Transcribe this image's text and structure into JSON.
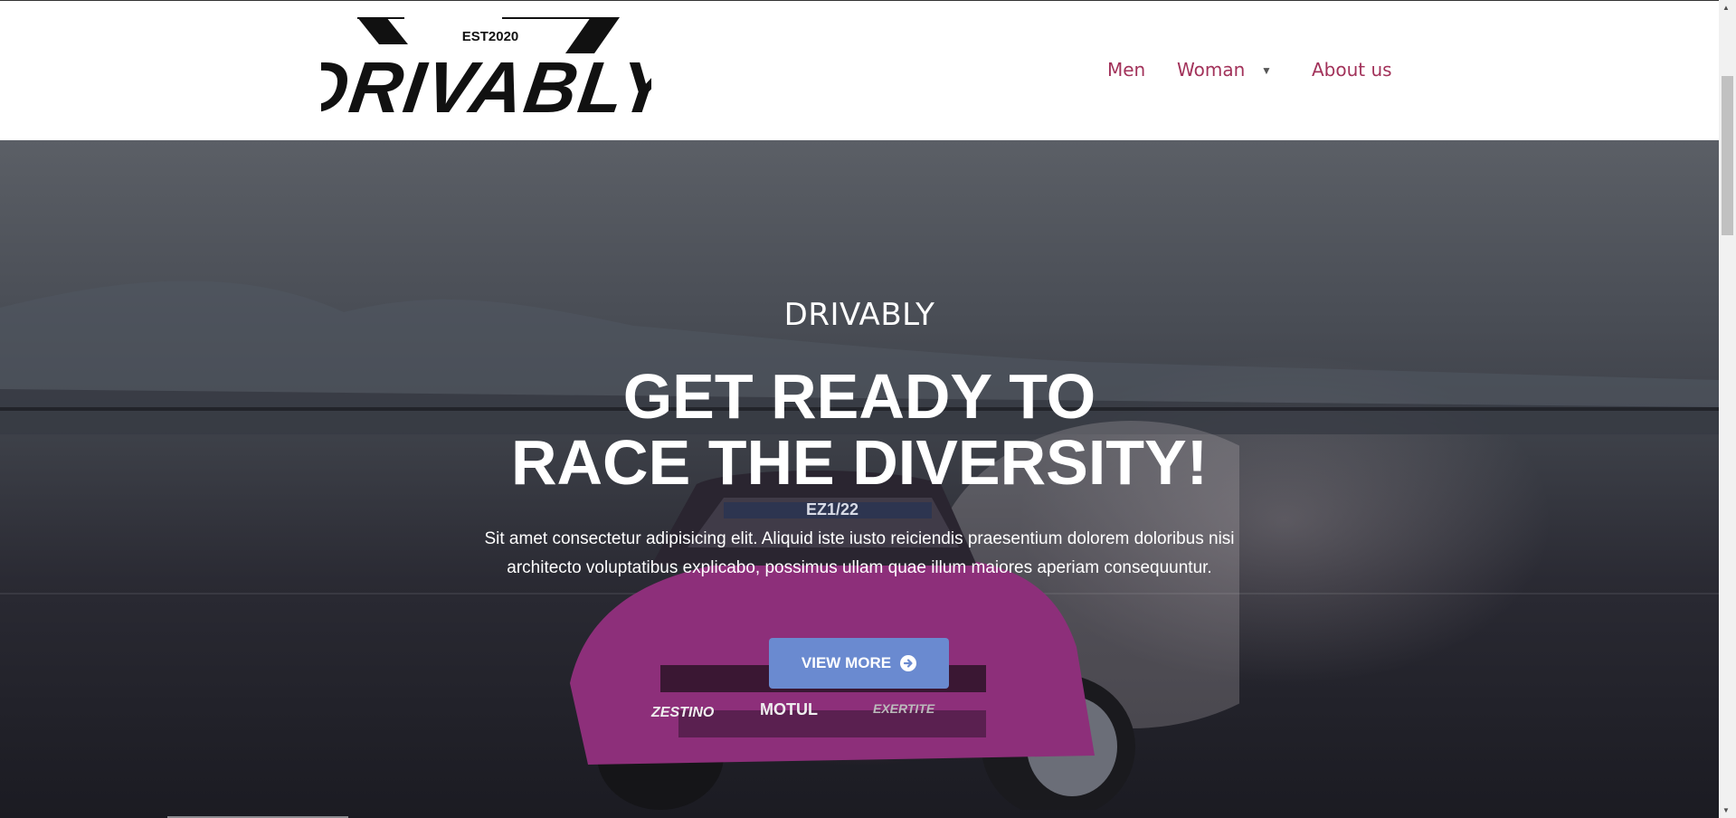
{
  "logo": {
    "tagline": "EST2020",
    "wordmark": "DRIVABLY"
  },
  "nav": {
    "items": [
      {
        "label": "Men"
      },
      {
        "label": "Woman",
        "has_dropdown": true,
        "dropdown_icon": "triangle-down-icon"
      },
      {
        "label": "About us"
      }
    ],
    "link_color": "#a2325a"
  },
  "hero": {
    "eyebrow": "DRIVABLY",
    "headline_line1": "GET READY TO",
    "headline_line2": "RACE THE DIVERSITY!",
    "body_line1": "Sit amet consectetur adipisicing elit. Aliquid iste iusto reiciendis praesentium dolorem doloribus nisi",
    "body_line2": "architecto voluptatibus explicabo, possimus ullam quae illum maiores aperiam consequuntur.",
    "cta_label": "VIEW MORE",
    "cta_icon": "arrow-circle-right-icon",
    "cta_color": "#6a8ad0",
    "car_decals": {
      "windshield": "EZ1/22",
      "bumper_left": "ZESTINO",
      "bumper_mid": "MOTUL",
      "bumper_right": "EXERTITE"
    }
  }
}
